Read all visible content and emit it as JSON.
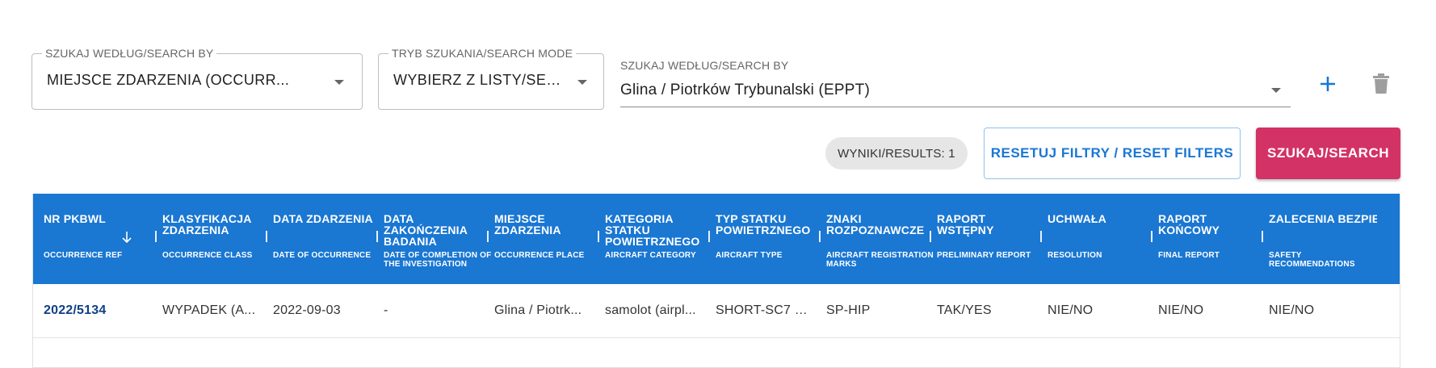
{
  "filters": {
    "search_by": {
      "legend": "SZUKAJ WEDŁUG/SEARCH BY",
      "value": "MIEJSCE ZDARZENIA (OCCURR..."
    },
    "search_mode": {
      "legend": "TRYB SZUKANIA/SEARCH MODE",
      "value": "WYBIERZ Z LISTY/SEL..."
    },
    "search_value": {
      "label": "SZUKAJ WEDŁUG/SEARCH BY",
      "value": "Glina / Piotrków Trybunalski (EPPT)"
    }
  },
  "icons": {
    "add": "plus-icon",
    "delete": "trash-icon",
    "sort": "arrow-down-icon",
    "accent": "#1a77d2",
    "muted": "#9e9e9e"
  },
  "results": {
    "label": "WYNIKI/RESULTS: 1"
  },
  "buttons": {
    "reset": "RESETUJ FILTRY / RESET FILTERS",
    "search": "SZUKAJ/SEARCH"
  },
  "colors": {
    "header_bg": "#1a77d2",
    "primary_button": "#d33266",
    "link": "#103f86"
  },
  "table": {
    "columns": [
      {
        "pl": "NR PKBWL",
        "en": "OCCURRENCE REF"
      },
      {
        "pl": "KLASYFIKACJA ZDARZENIA",
        "en": "OCCURRENCE CLASS"
      },
      {
        "pl": "DATA ZDARZENIA",
        "en": "DATE OF OCCURRENCE"
      },
      {
        "pl": "DATA ZAKOŃCZENIA BADANIA",
        "en": "DATE OF COMPLETION OF THE INVESTIGATION"
      },
      {
        "pl": "MIEJSCE ZDARZENIA",
        "en": "OCCURRENCE PLACE"
      },
      {
        "pl": "KATEGORIA STATKU POWIETRZNEGO",
        "en": "AIRCRAFT CATEGORY"
      },
      {
        "pl": "TYP STATKU POWIETRZNEGO",
        "en": "AIRCRAFT TYPE"
      },
      {
        "pl": "ZNAKI ROZPOZNAWCZE",
        "en": "AIRCRAFT REGISTRATION MARKS"
      },
      {
        "pl": "RAPORT WSTĘPNY",
        "en": "PRELIMINARY REPORT"
      },
      {
        "pl": "UCHWAŁA",
        "en": "RESOLUTION"
      },
      {
        "pl": "RAPORT KOŃCOWY",
        "en": "FINAL REPORT"
      },
      {
        "pl": "ZALECENIA BEZPIECZEŃSTW",
        "en": "SAFETY RECOMMENDATIONS"
      }
    ],
    "rows": [
      [
        "2022/5134",
        "WYPADEK (A...",
        "2022-09-03",
        "-",
        "Glina / Piotrk...",
        "samolot (airpl...",
        "SHORT-SC7 S...",
        "SP-HIP",
        "TAK/YES",
        "NIE/NO",
        "NIE/NO",
        "NIE/NO"
      ]
    ]
  }
}
